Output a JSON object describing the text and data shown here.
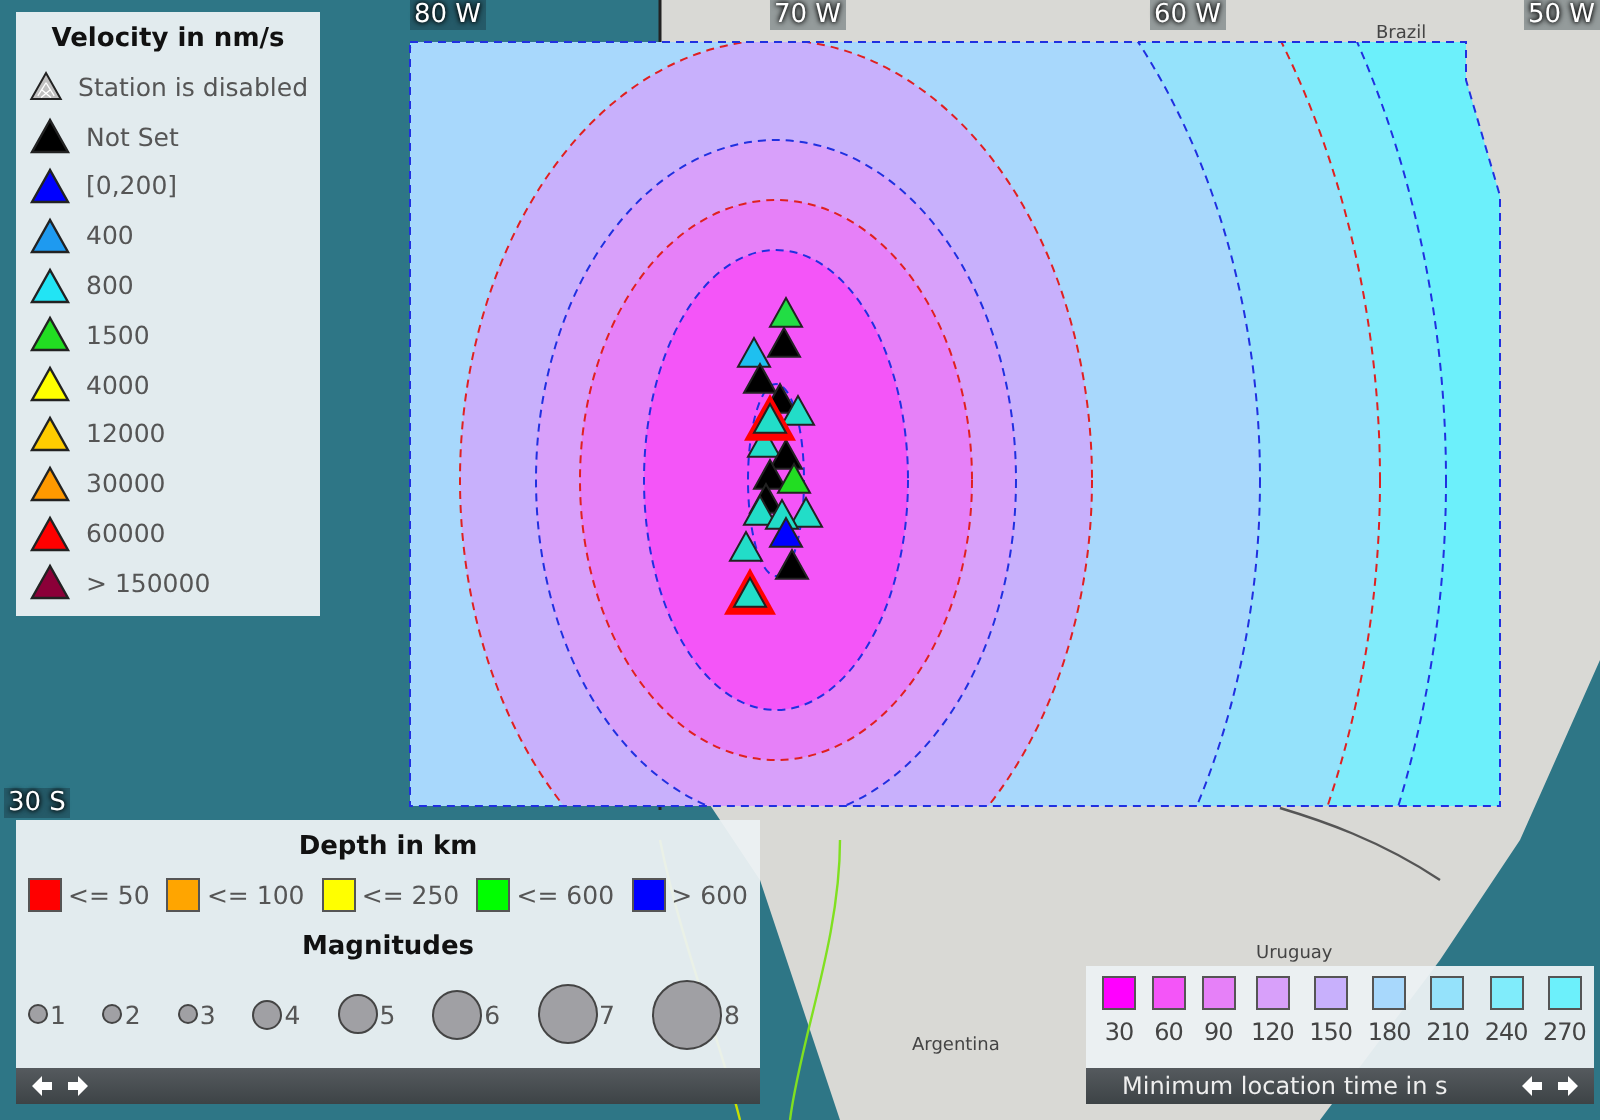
{
  "map": {
    "grid_labels": [
      "80 W",
      "70 W",
      "60 W",
      "50 W",
      "30 S"
    ],
    "place_labels": [
      "Brazil",
      "Uruguay",
      "Argentina"
    ]
  },
  "velocity_legend": {
    "title": "Velocity in nm/s",
    "items": [
      {
        "label": "Station is disabled",
        "color": "#c0c0c0",
        "disabled": true
      },
      {
        "label": "Not Set",
        "color": "#000000",
        "disabled": false
      },
      {
        "label": "[0,200]",
        "color": "#0000ff",
        "disabled": false
      },
      {
        "label": "400",
        "color": "#1e9af0",
        "disabled": false
      },
      {
        "label": "800",
        "color": "#22e4f4",
        "disabled": false
      },
      {
        "label": "1500",
        "color": "#22dd22",
        "disabled": false
      },
      {
        "label": "4000",
        "color": "#ffff00",
        "disabled": false
      },
      {
        "label": "12000",
        "color": "#ffcc00",
        "disabled": false
      },
      {
        "label": "30000",
        "color": "#ff9900",
        "disabled": false
      },
      {
        "label": "60000",
        "color": "#ff0000",
        "disabled": false
      },
      {
        "label": "> 150000",
        "color": "#8b0038",
        "disabled": false
      }
    ]
  },
  "depth_legend": {
    "title": "Depth in km",
    "items": [
      {
        "label": "<= 50",
        "color": "#ff0000"
      },
      {
        "label": "<= 100",
        "color": "#ffa500"
      },
      {
        "label": "<= 250",
        "color": "#ffff00"
      },
      {
        "label": "<= 600",
        "color": "#00ff00"
      },
      {
        "label": "> 600",
        "color": "#0000ff"
      }
    ],
    "magnitudes_title": "Magnitudes",
    "magnitudes": [
      "1",
      "2",
      "3",
      "4",
      "5",
      "6",
      "7",
      "8"
    ]
  },
  "time_legend": {
    "title": "Minimum location time in s",
    "items": [
      {
        "label": "30",
        "color": "#ff00ff"
      },
      {
        "label": "60",
        "color": "#f455f8"
      },
      {
        "label": "90",
        "color": "#e680f8"
      },
      {
        "label": "120",
        "color": "#d8a0fa"
      },
      {
        "label": "150",
        "color": "#c8b0fc"
      },
      {
        "label": "180",
        "color": "#a8d8fc"
      },
      {
        "label": "210",
        "color": "#95e2fb"
      },
      {
        "label": "240",
        "color": "#80ecfb"
      },
      {
        "label": "270",
        "color": "#6cf0fb"
      }
    ]
  }
}
